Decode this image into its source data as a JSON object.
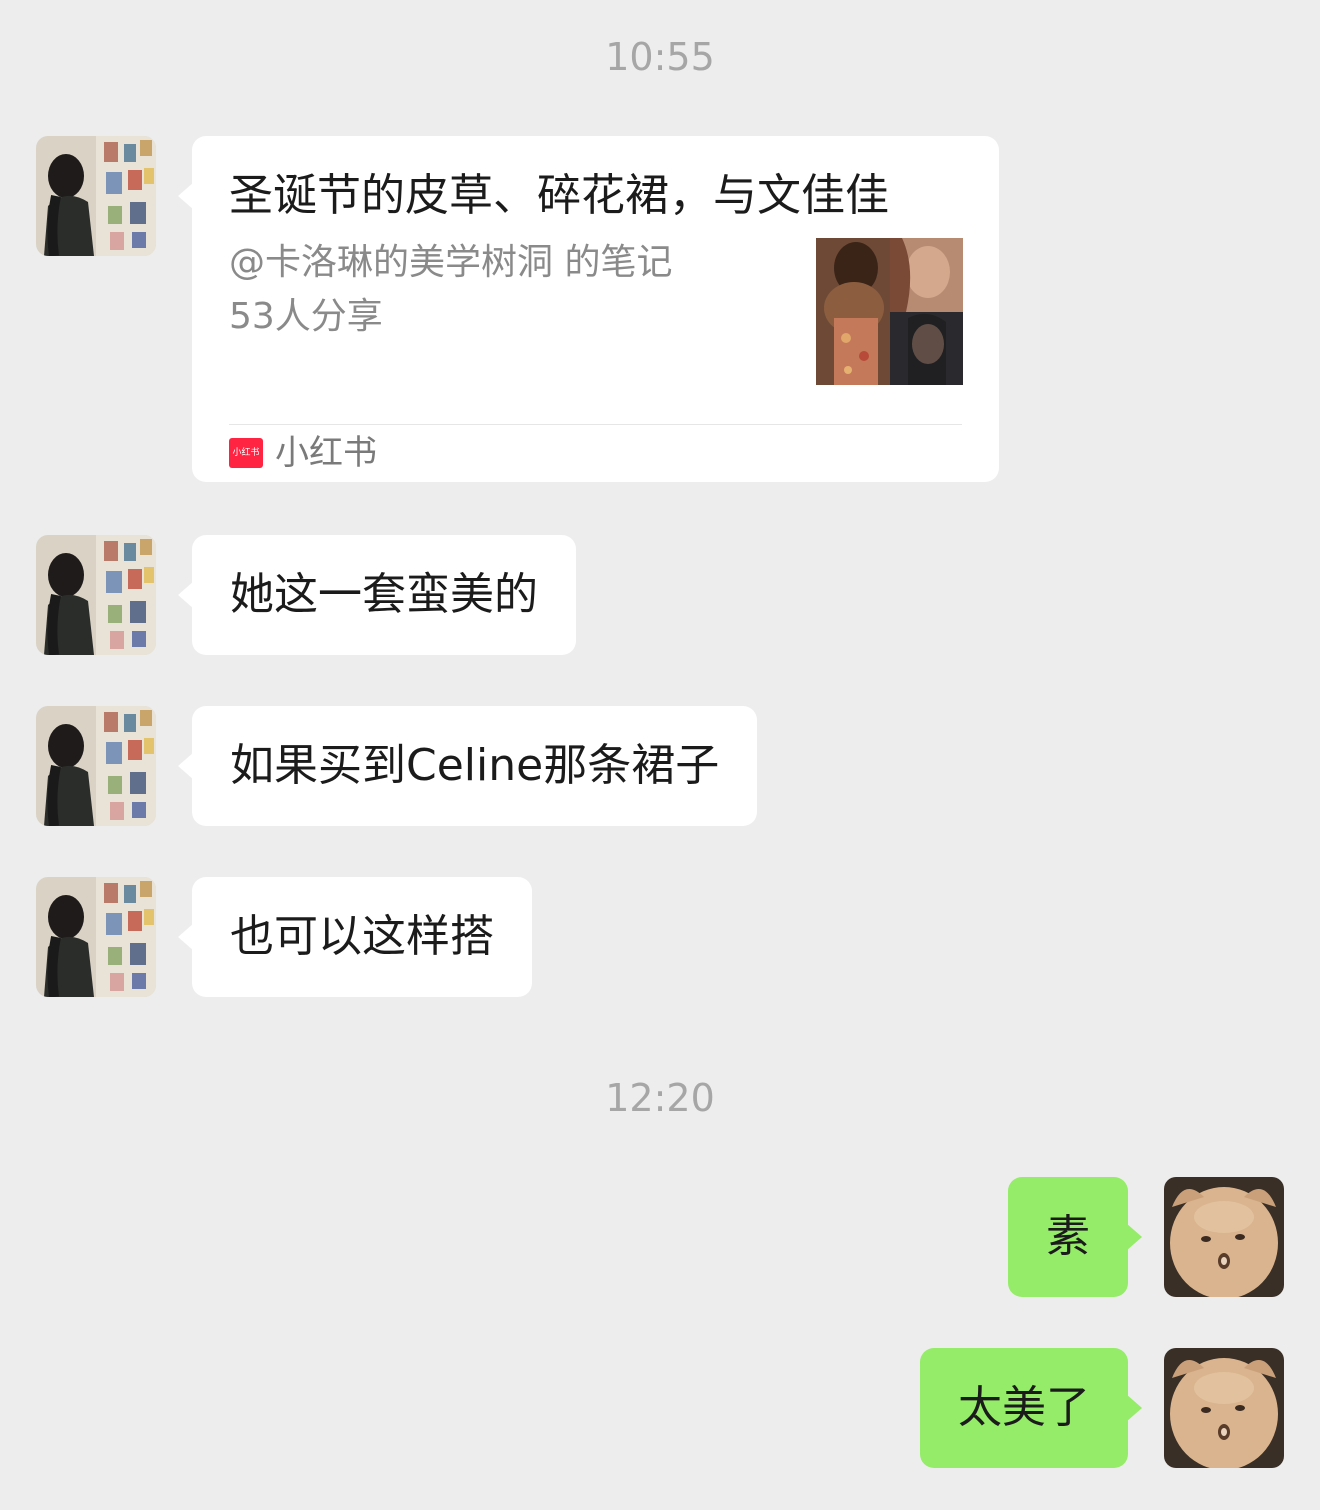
{
  "timestamps": [
    "10:55",
    "12:20"
  ],
  "card": {
    "title": "圣诞节的皮草、碎花裙，与文佳佳",
    "author": "@卡洛琳的美学树洞 的笔记",
    "shares": "53人分享",
    "source_logo": "小红书",
    "source": "小红书"
  },
  "incoming_messages": [
    "她这一套蛮美的",
    "如果买到Celine那条裙子",
    "也可以这样搭"
  ],
  "outgoing_messages": [
    "素",
    "太美了"
  ],
  "colors": {
    "background": "#ededed",
    "incoming_bubble": "#ffffff",
    "outgoing_bubble": "#95ec69",
    "timestamp_text": "#a6a6a6",
    "xiaohongshu_red": "#ff2442"
  },
  "icons": {
    "contact_avatar": "woman-in-gallery-photo",
    "self_avatar": "cat-face-photo",
    "source_logo": "xiaohongshu-logo"
  }
}
